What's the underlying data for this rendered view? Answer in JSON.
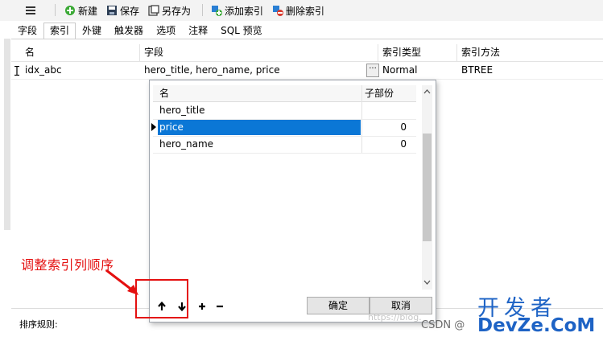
{
  "toolbar": {
    "new_label": "新建",
    "save_label": "保存",
    "save_as_label": "另存为",
    "add_index_label": "添加索引",
    "delete_index_label": "删除索引"
  },
  "tabs": [
    {
      "label": "字段"
    },
    {
      "label": "索引"
    },
    {
      "label": "外键"
    },
    {
      "label": "触发器"
    },
    {
      "label": "选项"
    },
    {
      "label": "注释"
    },
    {
      "label": "SQL 预览"
    }
  ],
  "active_tab": "索引",
  "grid": {
    "columns": [
      "名",
      "字段",
      "索引类型",
      "索引方法"
    ],
    "rows": [
      {
        "name": "idx_abc",
        "fields": "hero_title, hero_name, price",
        "type": "Normal",
        "method": "BTREE"
      }
    ]
  },
  "popup": {
    "columns": [
      "名",
      "子部份"
    ],
    "rows": [
      {
        "name": "hero_title",
        "sub": ""
      },
      {
        "name": "price",
        "sub": "0"
      },
      {
        "name": "hero_name",
        "sub": "0"
      }
    ],
    "selected_row": "price",
    "ok_label": "确定",
    "cancel_label": "取消"
  },
  "sort_label": "排序规则:",
  "annotation": {
    "text": "调整索引列顺序",
    "color": "#e41010"
  },
  "watermark": {
    "site_cn": "开发者",
    "site_en": "DevZe.CoM",
    "csdn": "CSDN @",
    "url_faded": "https://blog."
  },
  "colors": {
    "selection": "#0b77d6",
    "accent_red": "#e41010",
    "watermark_blue": "#1e63c5"
  }
}
